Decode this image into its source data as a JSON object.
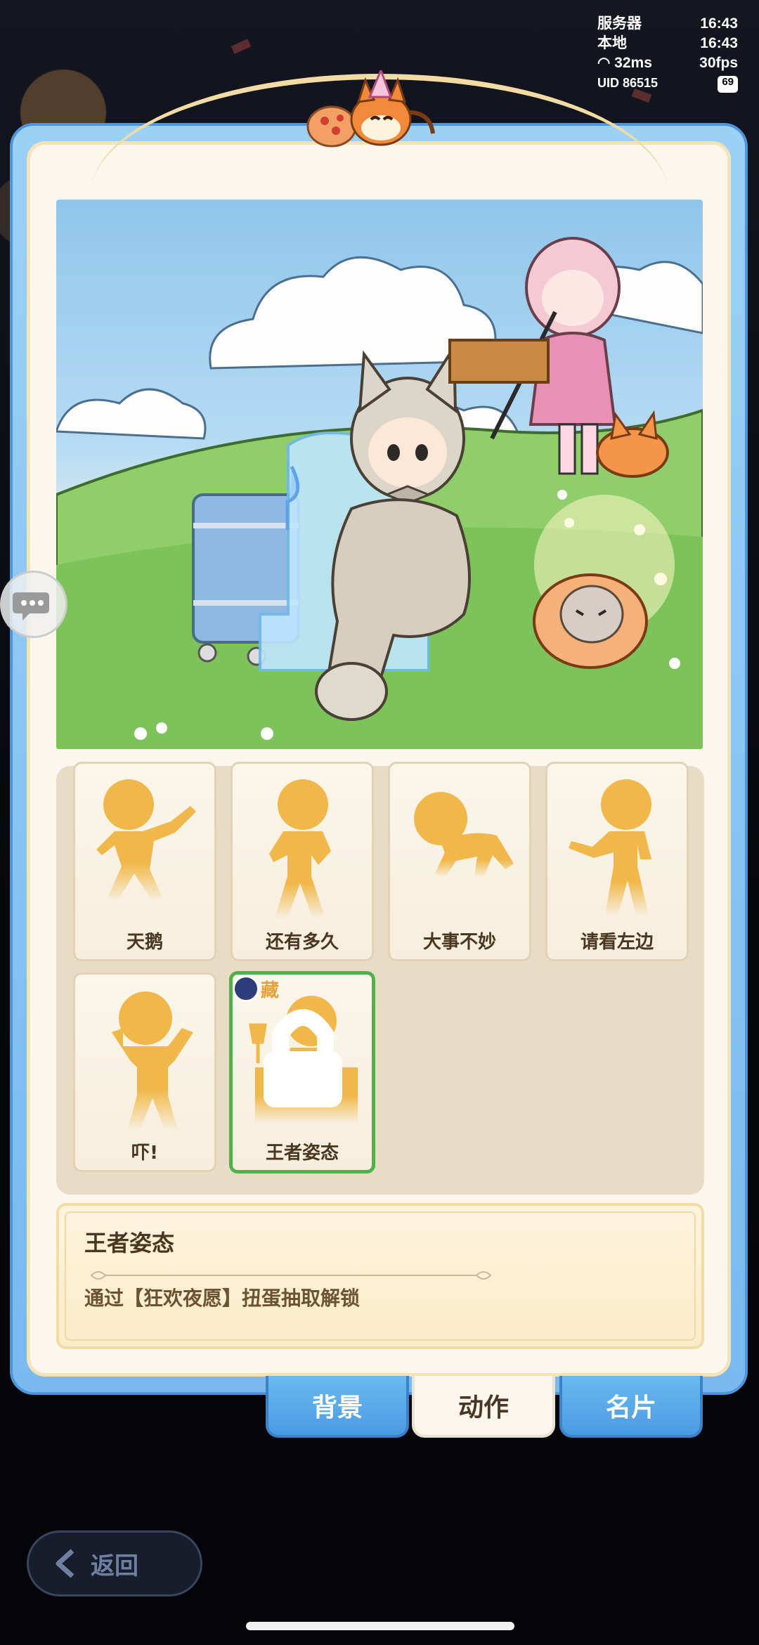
{
  "status": {
    "server_label": "服务器",
    "server_time": "16:43",
    "local_label": "本地",
    "local_time": "16:43",
    "ping": "32ms",
    "fps": "30fps",
    "uid": "UID 86515",
    "battery": "69"
  },
  "actions": [
    {
      "label": "天鹅",
      "selected": false
    },
    {
      "label": "还有多久",
      "selected": false
    },
    {
      "label": "大事不妙",
      "selected": false
    },
    {
      "label": "请看左边",
      "selected": false
    },
    {
      "label": "吓!",
      "selected": false
    },
    {
      "label": "王者姿态",
      "selected": true,
      "tag": "藏"
    }
  ],
  "description": {
    "title": "王者姿态",
    "text": "通过【狂欢夜愿】扭蛋抽取解锁"
  },
  "tabs": [
    {
      "label": "背景",
      "active": false
    },
    {
      "label": "动作",
      "active": true
    },
    {
      "label": "名片",
      "active": false
    }
  ],
  "back_label": "返回",
  "colors": {
    "frame_blue": "#79b9ee",
    "panel_cream": "#fbf7ee",
    "silhouette": "#f0b84a",
    "selected_green": "#4fb14a",
    "text_brown": "#4a3621"
  }
}
